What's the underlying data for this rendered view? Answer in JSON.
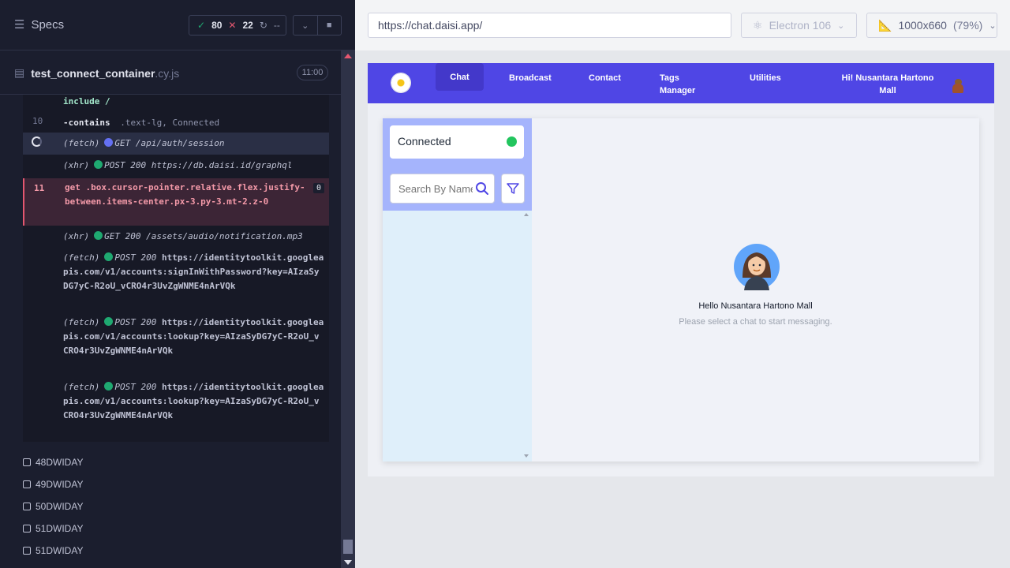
{
  "runner": {
    "specs_label": "Specs",
    "stats": {
      "passed": "80",
      "failed": "22",
      "pending": "--"
    },
    "spec_file": {
      "name": "test_connect_container",
      "ext": ".cy.js",
      "duration": "11:00"
    }
  },
  "commands": [
    {
      "num": "",
      "name": "include",
      "message": "/"
    },
    {
      "num": "10",
      "name": "-contains",
      "message": ".text-lg, Connected"
    },
    {
      "type": "(fetch)",
      "method": "GET",
      "url": "/api/auth/session"
    },
    {
      "type": "(xhr)",
      "method": "POST 200",
      "url": "https://db.daisi.id/graphql"
    },
    {
      "num": "11",
      "name": "get",
      "selector": ".box.cursor-pointer.relative.flex.justify-between.items-center.px-3.py-3.mt-2.z-0",
      "badge": "0"
    },
    {
      "type": "(xhr)",
      "method": "GET 200",
      "url": "/assets/audio/notification.mp3"
    },
    {
      "type": "(fetch)",
      "method": "POST 200",
      "url": "https://identitytoolkit.googleapis.com/v1/accounts:signInWithPassword?key=AIzaSyDG7yC-R2oU_vCRO4r3UvZgWNME4nArVQk"
    },
    {
      "type": "(fetch)",
      "method": "POST 200",
      "url": "https://identitytoolkit.googleapis.com/v1/accounts:lookup?key=AIzaSyDG7yC-R2oU_vCRO4r3UvZgWNME4nArVQk"
    },
    {
      "type": "(fetch)",
      "method": "POST 200",
      "url": "https://identitytoolkit.googleapis.com/v1/accounts:lookup?key=AIzaSyDG7yC-R2oU_vCRO4r3UvZgWNME4nArVQk"
    }
  ],
  "tests": [
    "48DWIDAY",
    "49DWIDAY",
    "50DWIDAY",
    "51DWIDAY",
    "51DWIDAY"
  ],
  "browser": {
    "url": "https://chat.daisi.app/",
    "engine": "Electron 106",
    "viewport": "1000x660",
    "scale": "(79%)"
  },
  "app": {
    "nav": [
      "Chat",
      "Broadcast",
      "Contact",
      "Tags Manager",
      "Utilities"
    ],
    "greeting": "Hi! Nusantara Hartono Mall",
    "status_label": "Connected",
    "search_placeholder": "Search By Name",
    "hello": "Hello Nusantara Hartono Mall",
    "subtitle": "Please select a chat to start messaging."
  },
  "colors": {
    "navbar": "#4f46e5",
    "connected": "#22c55e",
    "pass": "#1fa971",
    "fail": "#e45770"
  }
}
